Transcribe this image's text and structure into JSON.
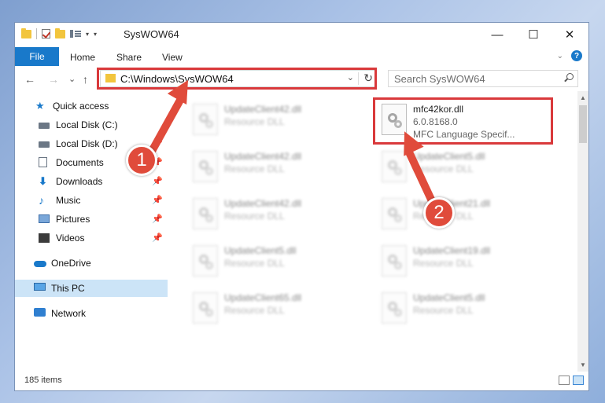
{
  "window": {
    "title": "SysWOW64"
  },
  "titlebar": {
    "minimize": "—",
    "maximize": "☐",
    "close": "✕"
  },
  "menu": {
    "file": "File",
    "home": "Home",
    "share": "Share",
    "view": "View",
    "help": "?"
  },
  "nav": {
    "back": "←",
    "forward": "→",
    "recent": "⌄",
    "up": "↑"
  },
  "address": {
    "path": "C:\\Windows\\SysWOW64",
    "dropdown": "⌄",
    "refresh": "↻"
  },
  "search": {
    "placeholder": "Search SysWOW64"
  },
  "sidebar": {
    "items": [
      {
        "label": "Quick access"
      },
      {
        "label": "Local Disk (C:)"
      },
      {
        "label": "Local Disk (D:)"
      },
      {
        "label": "Documents"
      },
      {
        "label": "Downloads"
      },
      {
        "label": "Music"
      },
      {
        "label": "Pictures"
      },
      {
        "label": "Videos"
      },
      {
        "label": "OneDrive"
      },
      {
        "label": "This PC"
      },
      {
        "label": "Network"
      }
    ]
  },
  "files": {
    "highlighted": {
      "name": "mfc42kor.dll",
      "version": "6.0.8168.0",
      "description": "MFC Language Specif..."
    },
    "blurred_left": [
      {
        "name": "UpdateClient42.dll",
        "type": "Resource DLL"
      },
      {
        "name": "UpdateClient42.dll",
        "type": "Resource DLL"
      },
      {
        "name": "UpdateClient42.dll",
        "type": "Resource DLL"
      },
      {
        "name": "UpdateClient5.dll",
        "type": "Resource DLL"
      },
      {
        "name": "UpdateClient65.dll",
        "type": "Resource DLL"
      }
    ],
    "blurred_right": [
      {
        "name": "UpdateClient5.dll",
        "type": "Resource DLL"
      },
      {
        "name": "UpdateClient21.dll",
        "type": "Resource DLL"
      },
      {
        "name": "UpdateClient19.dll",
        "type": "Resource DLL"
      },
      {
        "name": "UpdateClient5.dll",
        "type": "Resource DLL"
      }
    ]
  },
  "status": {
    "count": "185 items"
  },
  "annotations": {
    "badge1": "1",
    "badge2": "2",
    "color": "#e04b3b"
  }
}
